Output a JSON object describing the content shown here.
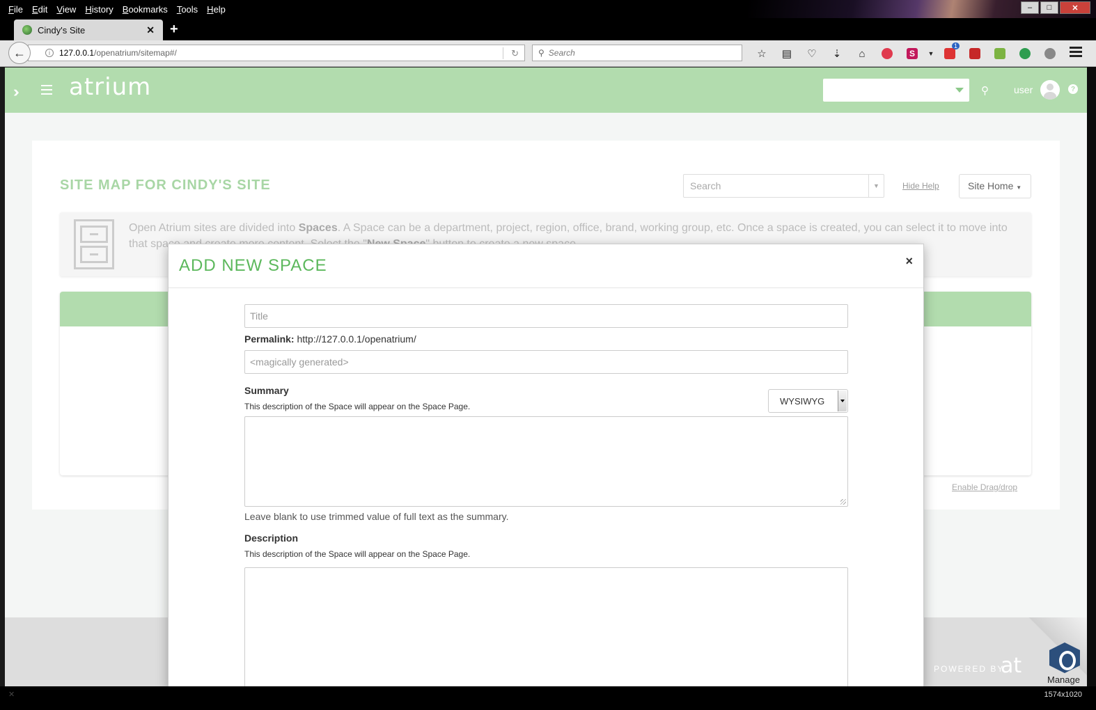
{
  "browser": {
    "menus": [
      "File",
      "Edit",
      "View",
      "History",
      "Bookmarks",
      "Tools",
      "Help"
    ],
    "tab_title": "Cindy's Site",
    "url_host": "127.0.0.1",
    "url_path": "/openatrium/sitemap#/",
    "search_placeholder": "Search",
    "mail_badge": "1",
    "resolution": "1574x1020"
  },
  "header": {
    "logo": "atrium",
    "user": "user"
  },
  "sitemap": {
    "title": "SITE MAP FOR CINDY'S SITE",
    "search_placeholder": "Search",
    "hide_help": "Hide Help",
    "site_home": "Site Home",
    "help_pre": "Open Atrium sites are divided into ",
    "help_spaces": "Spaces",
    "help_mid": ". A Space can be a department, project, region, office, brand, working group, etc. Once a space is created, you can select it to move into that space and create more content. Select the \"",
    "help_new_space": "New Space",
    "help_post": "\" button to create a new space.",
    "enable_drag": "Enable Drag/drop"
  },
  "footer": {
    "powered_by": "POWERED BY",
    "powered_logo": "at",
    "manage": "Manage"
  },
  "modal": {
    "title": "ADD NEW SPACE",
    "close": "×",
    "title_placeholder": "Title",
    "permalink_label": "Permalink:",
    "permalink_url": "http://127.0.0.1/openatrium/",
    "machine_placeholder": "<magically generated>",
    "summary_label": "Summary",
    "summary_desc": "This description of the Space will appear on the Space Page.",
    "format": "WYSIWYG",
    "summary_note": "Leave blank to use trimmed value of full text as the summary.",
    "description_label": "Description",
    "description_desc": "This description of the Space will appear on the Space Page."
  }
}
